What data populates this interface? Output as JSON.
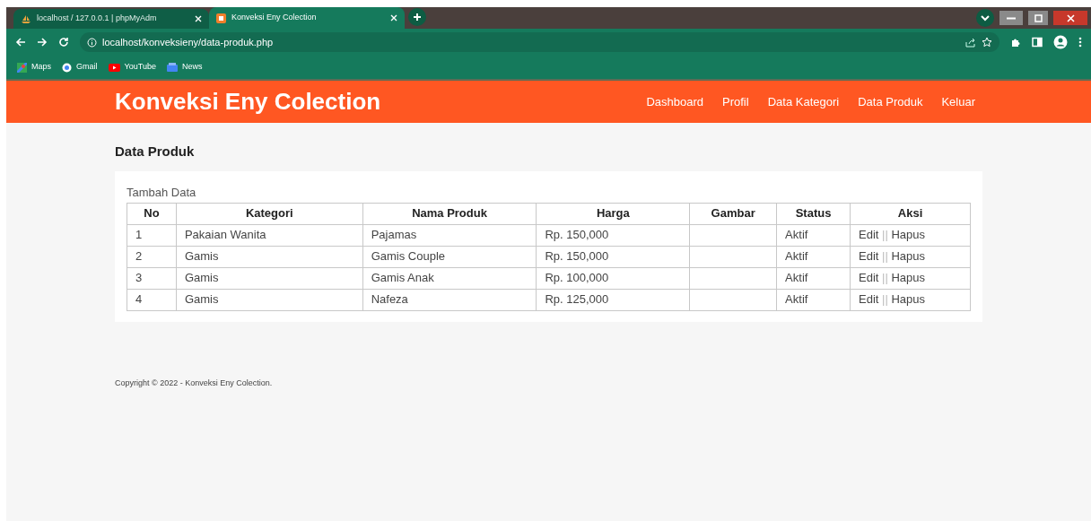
{
  "browser": {
    "tabs": [
      {
        "title": "localhost / 127.0.0.1 | phpMyAdm",
        "selected": false
      },
      {
        "title": "Konveksi Eny Colection",
        "selected": true
      }
    ],
    "url": "localhost/konveksieny/data-produk.php",
    "bookmarks": [
      "Maps",
      "Gmail",
      "YouTube",
      "News"
    ]
  },
  "header": {
    "brand": "Konveksi Eny Colection",
    "nav": [
      "Dashboard",
      "Profil",
      "Data Kategori",
      "Data Produk",
      "Keluar"
    ]
  },
  "page_title": "Data Produk",
  "add_link": "Tambah Data",
  "table": {
    "columns": [
      "No",
      "Kategori",
      "Nama Produk",
      "Harga",
      "Gambar",
      "Status",
      "Aksi"
    ],
    "rows": [
      {
        "no": "1",
        "kategori": "Pakaian Wanita",
        "nama": "Pajamas",
        "harga": "Rp. 150,000",
        "status": "Aktif",
        "edit": "Edit",
        "separator": "||",
        "hapus": "Hapus"
      },
      {
        "no": "2",
        "kategori": "Gamis",
        "nama": "Gamis Couple",
        "harga": "Rp. 150,000",
        "status": "Aktif",
        "edit": "Edit",
        "separator": "||",
        "hapus": "Hapus"
      },
      {
        "no": "3",
        "kategori": "Gamis",
        "nama": "Gamis Anak",
        "harga": "Rp. 100,000",
        "status": "Aktif",
        "edit": "Edit",
        "separator": "||",
        "hapus": "Hapus"
      },
      {
        "no": "4",
        "kategori": "Gamis",
        "nama": "Nafeza",
        "harga": "Rp. 125,000",
        "status": "Aktif",
        "edit": "Edit",
        "separator": "||",
        "hapus": "Hapus"
      }
    ]
  },
  "footer": "Copyright © 2022 - Konveksi Eny Colection."
}
